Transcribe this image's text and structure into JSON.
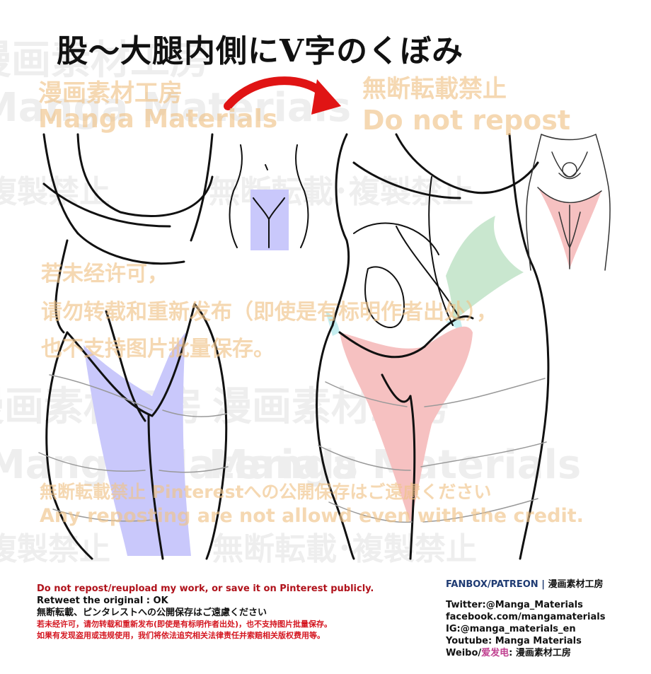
{
  "title": "股～大腿内側にV字のくぼみ",
  "watermarks": {
    "jp_studio": "漫画素材工房",
    "en_studio": "Manga Materials",
    "no_repost_jp": "無断転載禁止",
    "no_repost_en": "Do not repost",
    "no_copy_jp": "複製禁止",
    "cn_line1": "若未经许可，",
    "cn_line2": "请勿转载和重新发布（即使是有标明作者出处），",
    "cn_line3": "也不支持图片批量保存。",
    "pinterest_jp": "無断転載禁止 Pinterestへの公開保存はご遠慮ください",
    "credit_en": "Any reposting are not allowd even with the credit.",
    "no_repost_copy_jp": "無断転載･複製禁止"
  },
  "colors": {
    "blue_highlight": "#c9c8fb",
    "pink_highlight": "#f6c1c1",
    "green_highlight": "#c9e7cf",
    "cyan_highlight": "#c5eef0",
    "arrow_red": "#e01414",
    "watermark": "#f0c489",
    "footer_red": "#b0121b"
  },
  "footer": {
    "left": {
      "line1": "Do not repost/reupload my work, or save it on Pinterest publicly.",
      "line2": "Retweet the original : OK",
      "line3": "無断転載、ピンタレストへの公開保存はご遠慮ください",
      "line4": "若未经许可，请勿转载和重新发布(即使是有标明作者出处)，也不支持图片批量保存。",
      "line5": "如果有发现盗用或违规使用，我们将依法追究相关法律责任并索赔相关版权费用等。"
    },
    "right": {
      "fanbox": "FANBOX/PATREON",
      "sep": "|",
      "studio": "漫画素材工房",
      "twitter": "Twitter:@Manga_Materials",
      "facebook": "facebook.com/mangamaterials",
      "ig": "IG:@manga_materials_en",
      "youtube": "Youtube: Manga Materials",
      "weibo_prefix": "Weibo/",
      "weibo_name": "爱发电",
      "weibo_suffix": ": 漫画素材工房"
    }
  }
}
